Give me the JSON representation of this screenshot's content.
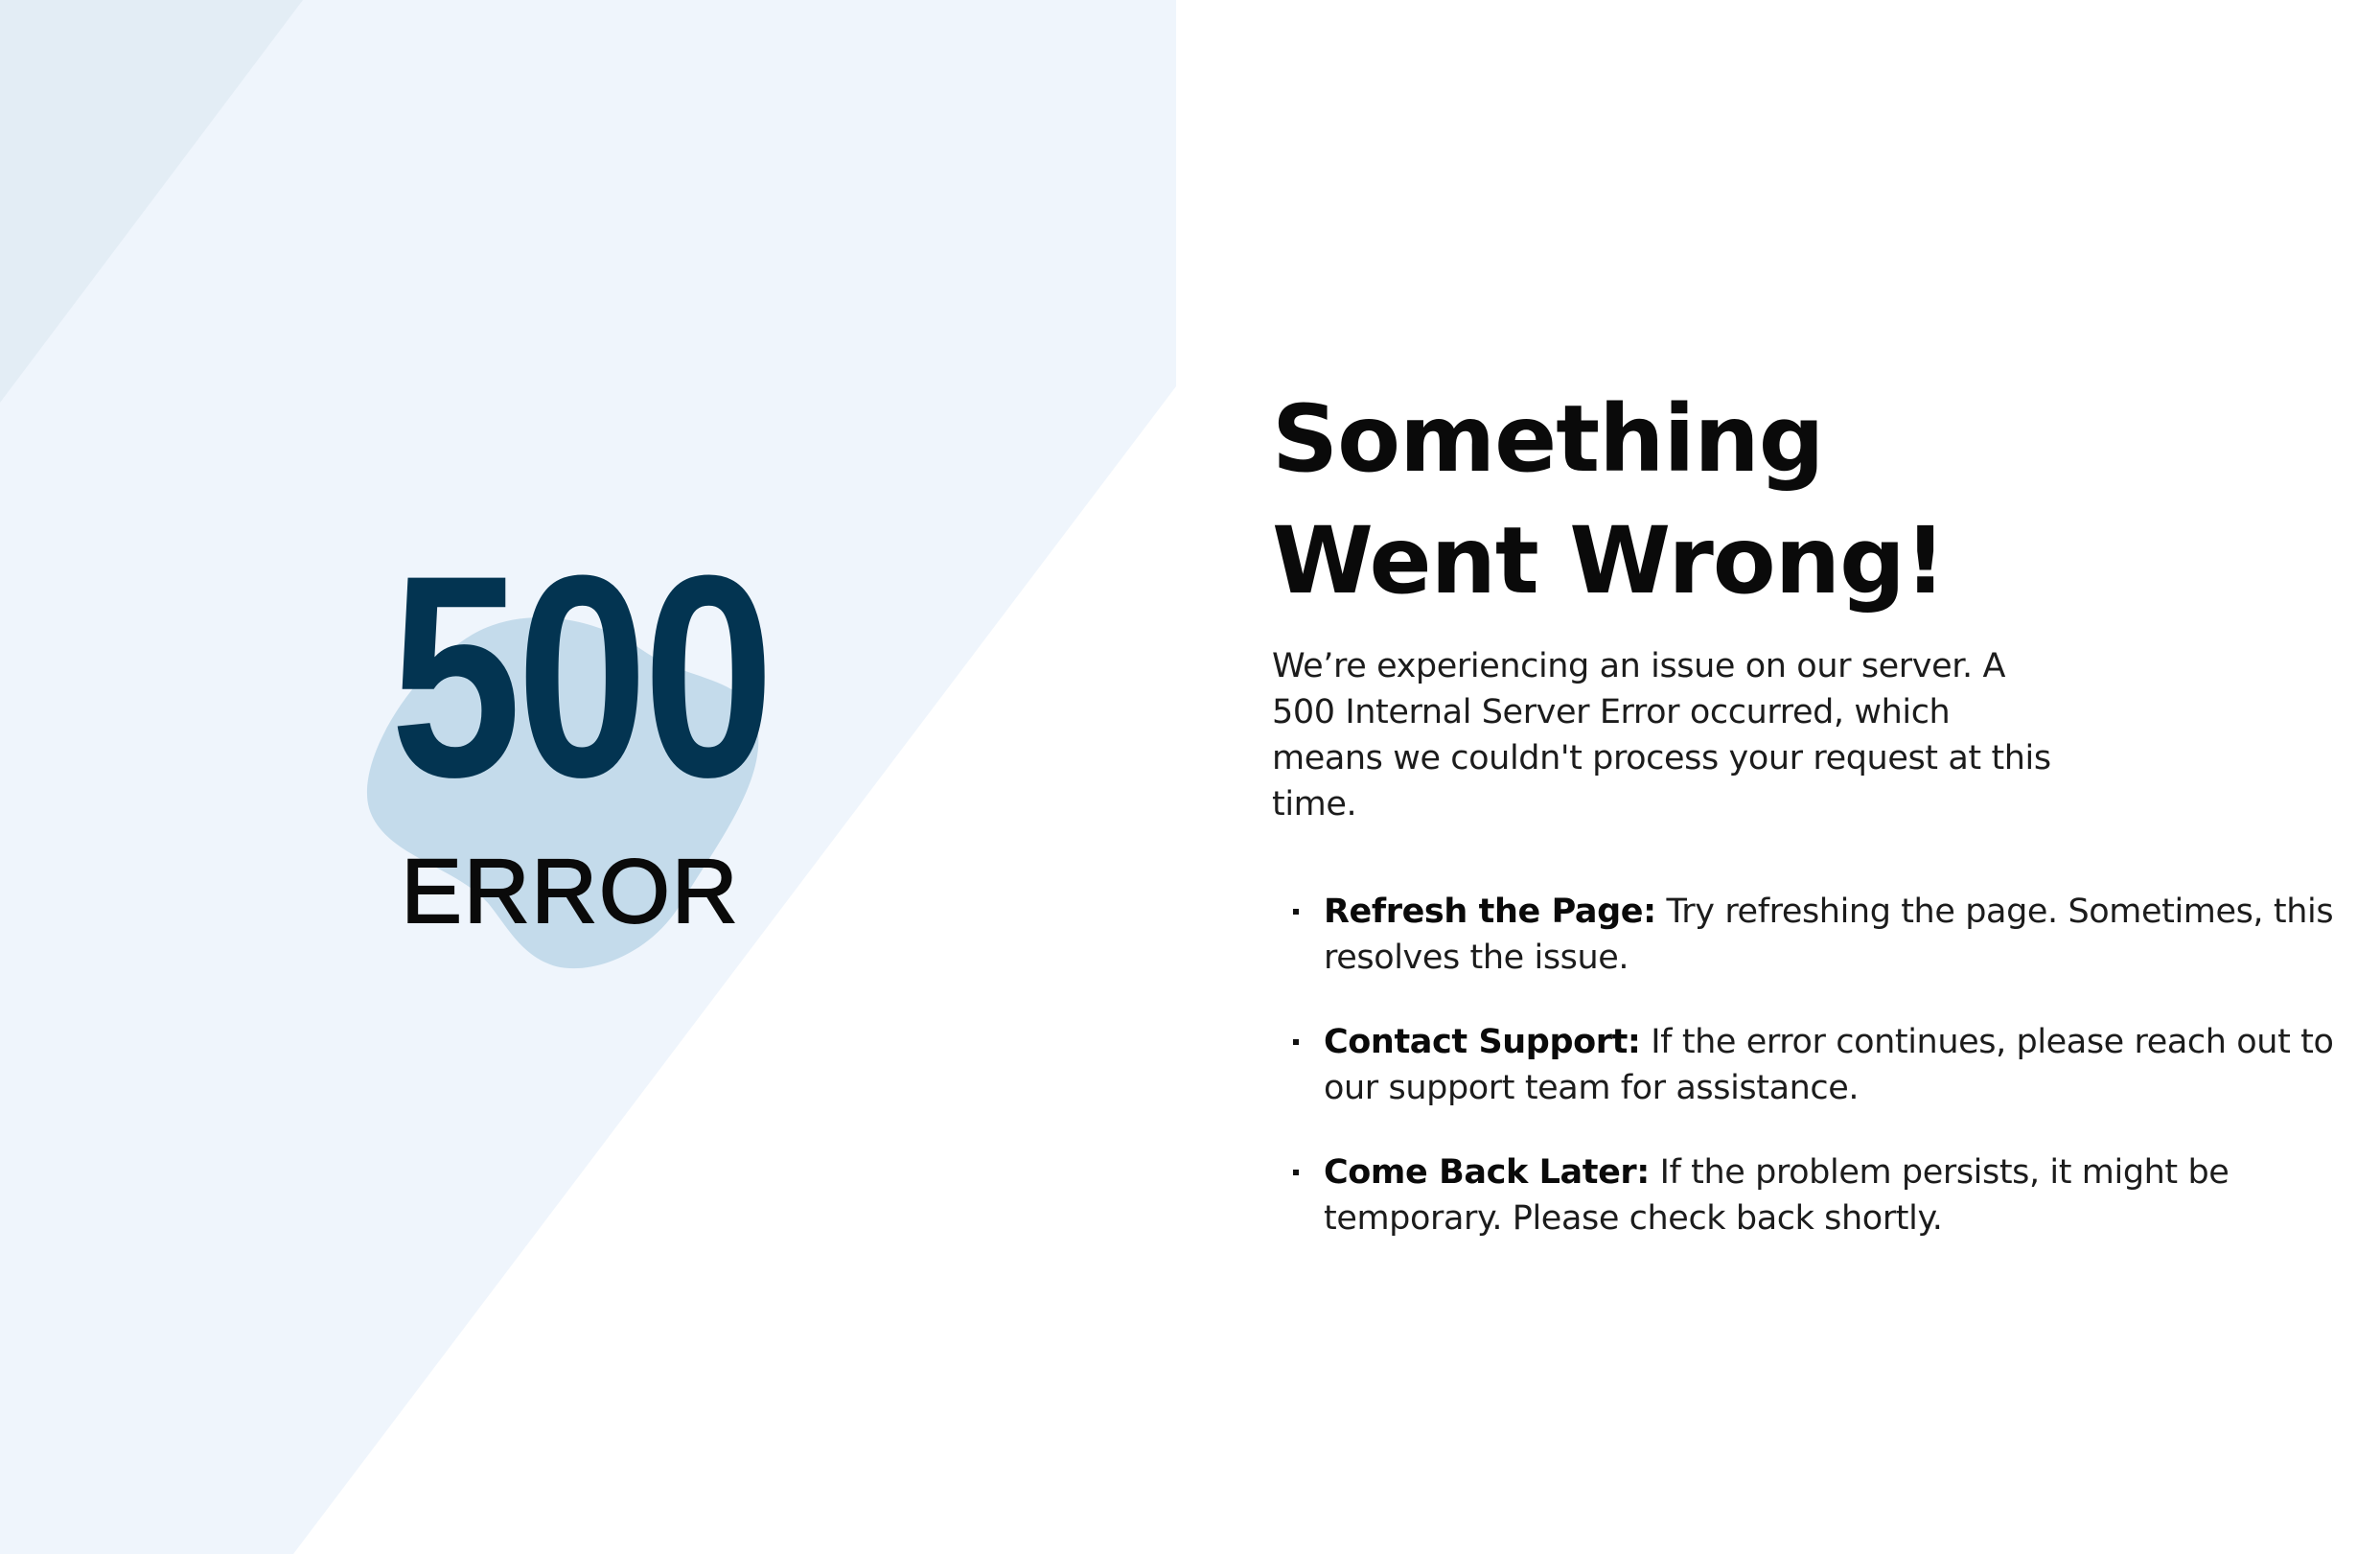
{
  "colors": {
    "page_background": "#ffffff",
    "panel_background": "#eff5fc",
    "panel_corner": "#e3edf5",
    "blob": "#c4dbeb",
    "error_code": "#033451",
    "text": "#111111"
  },
  "error_graphic": {
    "code": "500",
    "label": "ERROR"
  },
  "message": {
    "headline_line1": "Something",
    "headline_line2": "Went Wrong!",
    "intro": "We’re experiencing an issue on our server. A 500 Internal Server Error occurred, which means we couldn't process your request at this time."
  },
  "tips": [
    {
      "icon": "square-bullet-icon",
      "title": "Refresh the Page:",
      "text": " Try refreshing the page. Sometimes, this resolves the issue."
    },
    {
      "icon": "square-bullet-icon",
      "title": "Contact Support:",
      "text": " If the error continues, please reach out to our support team for assistance."
    },
    {
      "icon": "square-bullet-icon",
      "title": "Come Back Later:",
      "text": " If the problem persists, it might be temporary. Please check back shortly."
    }
  ]
}
